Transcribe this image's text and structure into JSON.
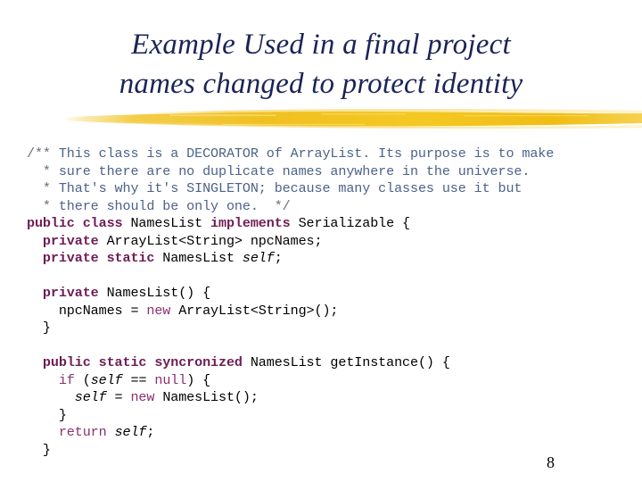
{
  "slide": {
    "title": {
      "line1": "Example Used in a final project",
      "line2": "names changed to protect identity"
    },
    "accent_color": "#f2c12b",
    "title_color": "#1b2456",
    "page_number": "8"
  },
  "code": {
    "language": "java",
    "colors": {
      "comment_marker": "#6d6d78",
      "comment_text": "#4c6289",
      "keyword_bold": "#6e1d55",
      "keyword": "#8a3070",
      "identifier": "#000000"
    },
    "lines": [
      {
        "id": "line-1",
        "tokens": [
          {
            "t": "/**",
            "c": "tok-cmt-mark"
          },
          {
            "t": " This class is a DECORATOR of ArrayList. Its purpose is to make",
            "c": "tok-cmt"
          }
        ]
      },
      {
        "id": "line-2",
        "tokens": [
          {
            "t": "  * ",
            "c": "tok-cmt-mark"
          },
          {
            "t": "sure there are no duplicate names anywhere in the universe.",
            "c": "tok-cmt"
          }
        ]
      },
      {
        "id": "line-3",
        "tokens": [
          {
            "t": "  * ",
            "c": "tok-cmt-mark"
          },
          {
            "t": "That's why it's SINGLETON; because many classes use it but",
            "c": "tok-cmt"
          }
        ]
      },
      {
        "id": "line-4",
        "tokens": [
          {
            "t": "  * ",
            "c": "tok-cmt-mark"
          },
          {
            "t": "there should be only one.  ",
            "c": "tok-cmt"
          },
          {
            "t": "*/",
            "c": "tok-cmt-mark"
          }
        ]
      },
      {
        "id": "line-5",
        "tokens": [
          {
            "t": "public class ",
            "c": "tok-kw-b"
          },
          {
            "t": "NamesList ",
            "c": "tok-id"
          },
          {
            "t": "implements ",
            "c": "tok-kw-b"
          },
          {
            "t": "Serializable {",
            "c": "tok-id"
          }
        ]
      },
      {
        "id": "line-6",
        "tokens": [
          {
            "t": "  ",
            "c": "tok-id"
          },
          {
            "t": "private ",
            "c": "tok-kw-b"
          },
          {
            "t": "ArrayList<String> npcNames;",
            "c": "tok-id"
          }
        ]
      },
      {
        "id": "line-7",
        "tokens": [
          {
            "t": "  ",
            "c": "tok-id"
          },
          {
            "t": "private static ",
            "c": "tok-kw-b"
          },
          {
            "t": "NamesList ",
            "c": "tok-id"
          },
          {
            "t": "self",
            "c": "tok-it"
          },
          {
            "t": ";",
            "c": "tok-id"
          }
        ]
      },
      {
        "id": "line-8",
        "tokens": []
      },
      {
        "id": "line-9",
        "tokens": [
          {
            "t": "  ",
            "c": "tok-id"
          },
          {
            "t": "private ",
            "c": "tok-kw-b"
          },
          {
            "t": "NamesList() {",
            "c": "tok-id"
          }
        ]
      },
      {
        "id": "line-10",
        "tokens": [
          {
            "t": "    npcNames = ",
            "c": "tok-id"
          },
          {
            "t": "new ",
            "c": "tok-kw"
          },
          {
            "t": "ArrayList<String>();",
            "c": "tok-id"
          }
        ]
      },
      {
        "id": "line-11",
        "tokens": [
          {
            "t": "  }",
            "c": "tok-id"
          }
        ]
      },
      {
        "id": "line-12",
        "tokens": []
      },
      {
        "id": "line-13",
        "tokens": [
          {
            "t": "  ",
            "c": "tok-id"
          },
          {
            "t": "public static syncronized ",
            "c": "tok-kw-b"
          },
          {
            "t": "NamesList getInstance() {",
            "c": "tok-id"
          }
        ]
      },
      {
        "id": "line-14",
        "tokens": [
          {
            "t": "    ",
            "c": "tok-id"
          },
          {
            "t": "if ",
            "c": "tok-kw"
          },
          {
            "t": "(",
            "c": "tok-id"
          },
          {
            "t": "self",
            "c": "tok-it"
          },
          {
            "t": " == ",
            "c": "tok-id"
          },
          {
            "t": "null",
            "c": "tok-kw"
          },
          {
            "t": ") {",
            "c": "tok-id"
          }
        ]
      },
      {
        "id": "line-15",
        "tokens": [
          {
            "t": "      ",
            "c": "tok-id"
          },
          {
            "t": "self",
            "c": "tok-it"
          },
          {
            "t": " = ",
            "c": "tok-id"
          },
          {
            "t": "new ",
            "c": "tok-kw"
          },
          {
            "t": "NamesList();",
            "c": "tok-id"
          }
        ]
      },
      {
        "id": "line-16",
        "tokens": [
          {
            "t": "    }",
            "c": "tok-id"
          }
        ]
      },
      {
        "id": "line-17",
        "tokens": [
          {
            "t": "    ",
            "c": "tok-id"
          },
          {
            "t": "return ",
            "c": "tok-kw"
          },
          {
            "t": "self",
            "c": "tok-it"
          },
          {
            "t": ";",
            "c": "tok-id"
          }
        ]
      },
      {
        "id": "line-18",
        "tokens": [
          {
            "t": "  }",
            "c": "tok-id"
          }
        ]
      }
    ]
  }
}
